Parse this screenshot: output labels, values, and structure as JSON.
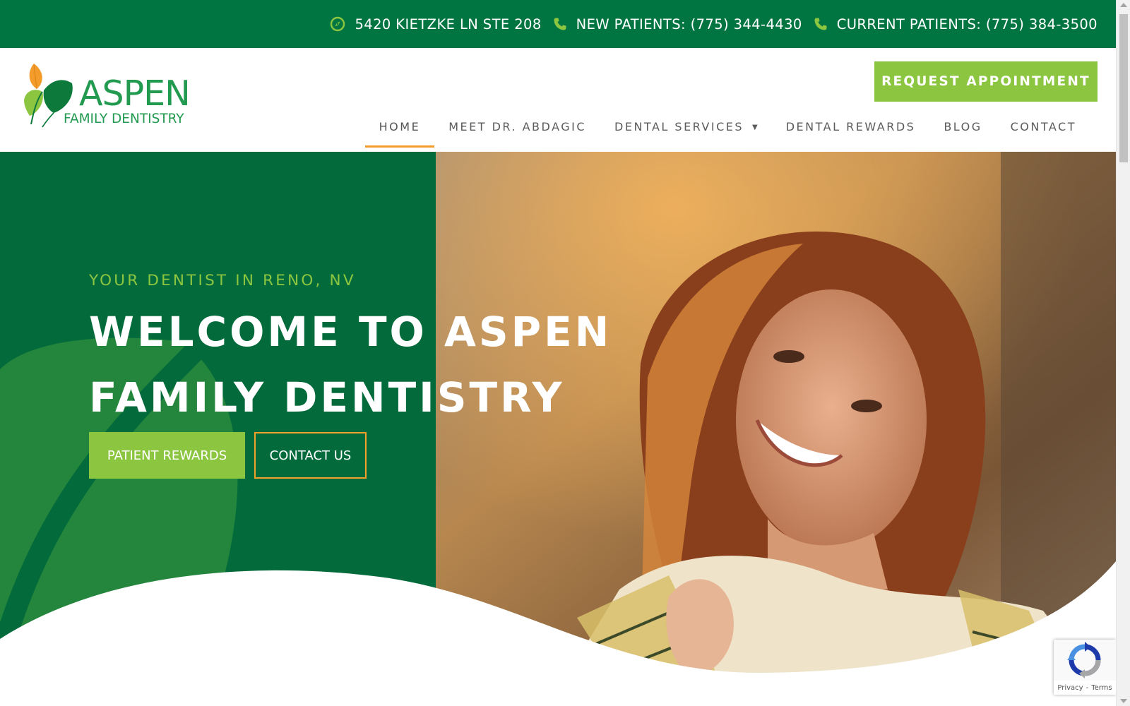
{
  "topbar": {
    "address": "5420 KIETZKE LN STE 208",
    "new_patients": "NEW PATIENTS: (775) 344-4430",
    "current_patients": "CURRENT PATIENTS: (775) 384-3500",
    "icons": [
      "compass-icon",
      "phone-icon",
      "phone-icon"
    ]
  },
  "header": {
    "logo": {
      "wordmark": "ASPEN",
      "subtitle": "FAMILY DENTISTRY"
    },
    "request_button": "REQUEST APPOINTMENT",
    "nav": [
      {
        "label": "HOME",
        "active": true
      },
      {
        "label": "MEET DR. ABDAGIC"
      },
      {
        "label": "DENTAL SERVICES",
        "has_dropdown": true
      },
      {
        "label": "DENTAL REWARDS"
      },
      {
        "label": "BLOG"
      },
      {
        "label": "CONTACT"
      }
    ]
  },
  "hero": {
    "kicker": "YOUR DENTIST IN RENO, NV",
    "headline_line1": "WELCOME TO ASPEN",
    "headline_line2": "FAMILY DENTISTRY",
    "primary_button": "PATIENT REWARDS",
    "secondary_button": "CONTACT US"
  },
  "recaptcha": {
    "privacy": "Privacy",
    "separator": "-",
    "terms": "Terms"
  },
  "colors": {
    "brand_green": "#007541",
    "hero_green": "#036b3b",
    "accent_lime": "#8cc641",
    "accent_orange": "#f39c2b",
    "logo_green": "#229a4f"
  }
}
